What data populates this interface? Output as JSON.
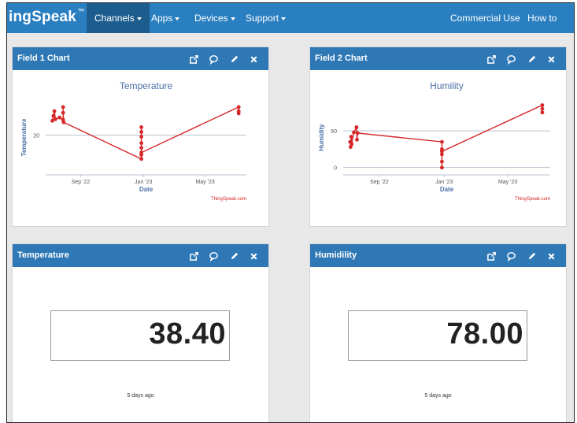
{
  "nav": {
    "brand": "ingSpeak",
    "brand_tm": "™",
    "items": [
      {
        "label": "Channels",
        "active": true
      },
      {
        "label": "Apps",
        "active": false
      },
      {
        "label": "Devices",
        "active": false
      },
      {
        "label": "Support",
        "active": false
      }
    ],
    "right_items": [
      {
        "label": "Commercial Use"
      },
      {
        "label": "How to Buy"
      }
    ]
  },
  "panels": [
    {
      "title": "Field 1 Chart"
    },
    {
      "title": "Field 2 Chart"
    },
    {
      "title": "Temperature",
      "value": "38.40",
      "ago": "5 days ago"
    },
    {
      "title": "Humidility",
      "value": "78.00",
      "ago": "5 days ago"
    }
  ],
  "icons": [
    "external-link-icon",
    "comment-icon",
    "pencil-icon",
    "close-icon"
  ],
  "colors": {
    "nav": "#2a7fc0",
    "nav_active": "#1d5d8e",
    "panel_head": "#2e78b6",
    "series": "#d62728",
    "axis_text": "#4a6fa5"
  },
  "chart_data": [
    {
      "type": "line",
      "title": "Temperature",
      "xlabel": "Date",
      "ylabel": "Temperature",
      "x_ticks": [
        "Sep '22",
        "Jan '23",
        "May '23"
      ],
      "y_ticks": [
        "20"
      ],
      "credit": "ThingSpeak.com",
      "series": [
        {
          "values": [
            [
              "2022-07-08",
              24.5
            ],
            [
              "2022-07-10",
              26.0
            ],
            [
              "2022-07-12",
              27.5
            ],
            [
              "2022-07-14",
              25.0
            ],
            [
              "2022-07-22",
              25.5
            ],
            [
              "2022-07-29",
              24.8
            ],
            [
              "2022-07-29",
              28.8
            ],
            [
              "2022-07-29",
              27.0
            ],
            [
              "2022-07-30",
              24.0
            ],
            [
              "2022-12-28",
              12.5
            ],
            [
              "2022-12-28",
              13.8
            ],
            [
              "2022-12-28",
              16.0
            ],
            [
              "2022-12-28",
              17.5
            ],
            [
              "2022-12-28",
              19.5
            ],
            [
              "2022-12-28",
              21.0
            ],
            [
              "2022-12-28",
              22.5
            ],
            [
              "2022-12-28",
              14.5
            ],
            [
              "2023-07-05",
              28.8
            ],
            [
              "2023-07-05",
              27.5
            ],
            [
              "2023-07-05",
              26.8
            ]
          ]
        }
      ]
    },
    {
      "type": "line",
      "title": "Humility",
      "xlabel": "Date",
      "ylabel": "Humidity",
      "x_ticks": [
        "Sep '22",
        "Jan '23",
        "May '23"
      ],
      "y_ticks": [
        "50",
        "0"
      ],
      "credit": "ThingSpeak.com",
      "series": [
        {
          "values": [
            [
              "2022-07-08",
              35
            ],
            [
              "2022-07-09",
              28
            ],
            [
              "2022-07-10",
              42
            ],
            [
              "2022-07-11",
              32
            ],
            [
              "2022-07-15",
              48
            ],
            [
              "2022-07-20",
              55
            ],
            [
              "2022-07-21",
              38
            ],
            [
              "2022-07-22",
              47
            ],
            [
              "2022-12-28",
              35
            ],
            [
              "2022-12-28",
              25
            ],
            [
              "2022-12-28",
              18
            ],
            [
              "2022-12-28",
              8
            ],
            [
              "2022-12-28",
              0
            ],
            [
              "2022-12-28",
              22
            ],
            [
              "2023-07-05",
              85
            ],
            [
              "2023-07-05",
              80
            ],
            [
              "2023-07-05",
              75
            ]
          ]
        }
      ]
    }
  ]
}
